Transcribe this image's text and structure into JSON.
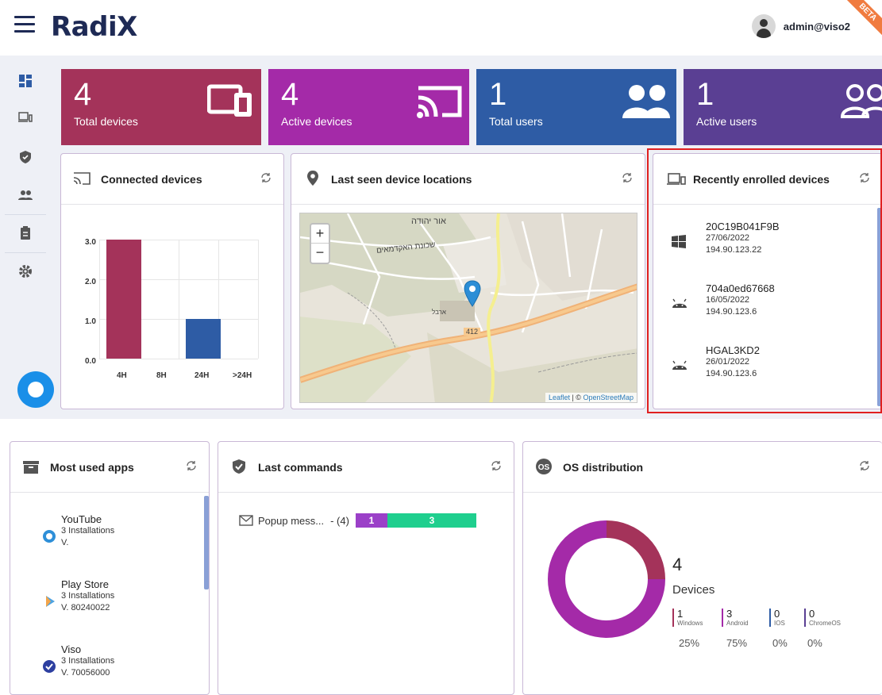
{
  "header": {
    "logo": "RadiX",
    "user": "admin@viso2",
    "beta": "BETA"
  },
  "kpis": [
    {
      "value": "4",
      "label": "Total devices",
      "color": "#a4335a",
      "icon": "devices-icon"
    },
    {
      "value": "4",
      "label": "Active devices",
      "color": "#a42aa8",
      "icon": "cast-icon"
    },
    {
      "value": "1",
      "label": "Total users",
      "color": "#2e5ca5",
      "icon": "users-icon"
    },
    {
      "value": "1",
      "label": "Active users",
      "color": "#5a3f93",
      "icon": "users-outline-icon"
    }
  ],
  "connected": {
    "title": "Connected devices",
    "y_ticks": [
      "3.0",
      "2.0",
      "1.0",
      "0.0"
    ],
    "x_ticks": [
      "4H",
      "8H",
      "24H",
      ">24H"
    ]
  },
  "chart_data": {
    "type": "bar",
    "categories": [
      "4H",
      "8H",
      "24H",
      ">24H"
    ],
    "values": [
      3,
      0,
      1,
      0
    ],
    "colors": [
      "#a4335a",
      "#a4335a",
      "#2e5ca5",
      "#2e5ca5"
    ],
    "ylim": [
      0,
      3
    ],
    "grid": true
  },
  "locations": {
    "title": "Last seen device locations",
    "zoom_in": "+",
    "zoom_out": "−",
    "attrib_leaflet": "Leaflet",
    "attrib_sep": " | © ",
    "attrib_osm": "OpenStreetMap",
    "map_labels": [
      "אור יהודה",
      "שכונת האקדמאים",
      "412",
      "ארבל"
    ]
  },
  "recent": {
    "title": "Recently enrolled devices",
    "items": [
      {
        "name": "20C19B041F9B",
        "date": "27/06/2022",
        "ip": "194.90.123.22",
        "os": "windows"
      },
      {
        "name": "704a0ed67668",
        "date": "16/05/2022",
        "ip": "194.90.123.6",
        "os": "android"
      },
      {
        "name": "HGAL3KD2",
        "date": "26/01/2022",
        "ip": "194.90.123.6",
        "os": "android"
      }
    ]
  },
  "apps": {
    "title": "Most used apps",
    "items": [
      {
        "name": "YouTube",
        "installs": "3 Installations",
        "version": "V."
      },
      {
        "name": "Play Store",
        "installs": "3 Installations",
        "version": "V. 80240022"
      },
      {
        "name": "Viso",
        "installs": "3 Installations",
        "version": "V. 70056000"
      }
    ]
  },
  "commands": {
    "title": "Last commands",
    "items": [
      {
        "label": "Popup mess...",
        "count": "- (4)",
        "pending": "1",
        "done": "3"
      }
    ]
  },
  "os": {
    "title": "OS distribution",
    "total": "4",
    "label": "Devices",
    "stats": [
      {
        "n": "1",
        "name": "Windows",
        "pct": "25%",
        "color": "#a4335a"
      },
      {
        "n": "3",
        "name": "Android",
        "pct": "75%",
        "color": "#a42aa8"
      },
      {
        "n": "0",
        "name": "IOS",
        "pct": "0%",
        "color": "#2e5ca5"
      },
      {
        "n": "0",
        "name": "ChromeOS",
        "pct": "0%",
        "color": "#5a3f93"
      }
    ],
    "donut": [
      {
        "value": 1,
        "color": "#a4335a"
      },
      {
        "value": 3,
        "color": "#a42aa8"
      }
    ]
  }
}
